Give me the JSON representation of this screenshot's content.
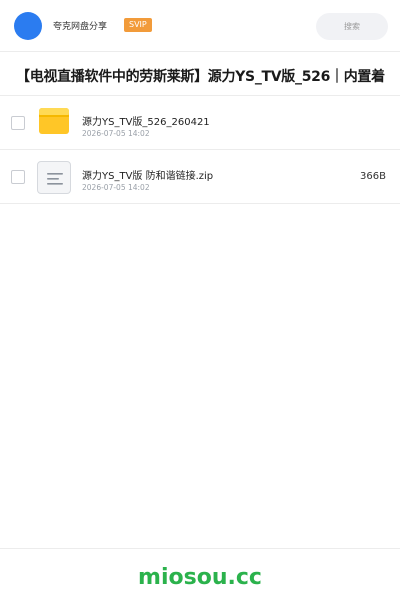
{
  "header": {
    "brand": "夸克网盘分享",
    "badge": "SVIP",
    "search_placeholder": "搜索"
  },
  "share": {
    "title": "【电视直播软件中的劳斯莱斯】源力YS_TV版_526｜内置着"
  },
  "files": [
    {
      "name": "源力YS_TV版_526_260421",
      "date": "2026-07-05 14:02",
      "size": "",
      "icon": "folder-icon"
    },
    {
      "name": "源力YS_TV版 防和谐链接.zip",
      "date": "2026-07-05 14:02",
      "size": "366B",
      "icon": "zip-file-icon"
    }
  ],
  "footer": {
    "watermark": "miosou.cc"
  },
  "colors": {
    "accent_blue": "#2b7cf0",
    "svip_orange": "#f29b3a",
    "folder_yellow": "#ffc627",
    "watermark_green": "#2bb24c"
  }
}
